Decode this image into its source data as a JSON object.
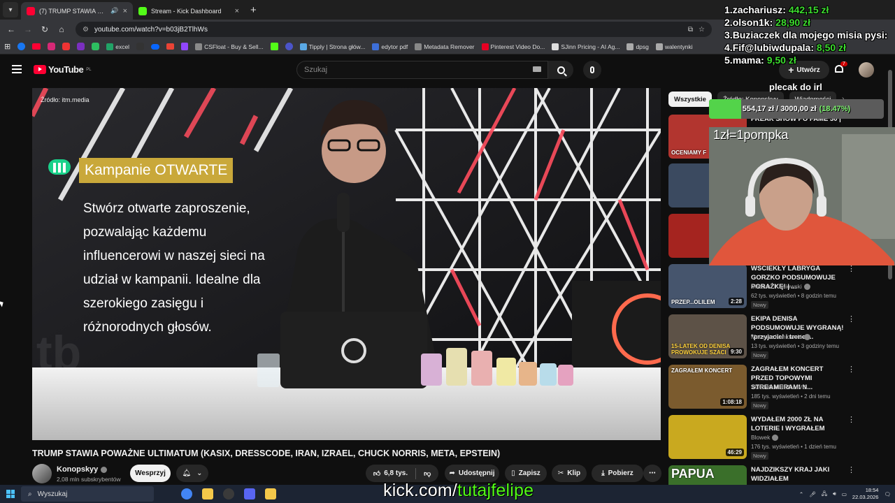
{
  "browser": {
    "tabs": [
      {
        "title": "(7) TRUMP STAWIA POWAŻ",
        "favicon_color": "#ff0033",
        "active": true
      },
      {
        "title": "Stream - Kick Dashboard",
        "favicon_color": "#53fc18",
        "active": false
      }
    ],
    "new_tab_icon": "plus-icon",
    "url": "youtube.com/watch?v=b03jB2TlhWs",
    "bookmarks": [
      {
        "label": "excel",
        "color": "#21a366"
      },
      {
        "label": "CSFloat - Buy & Sell...",
        "color": "#8a8a8a"
      },
      {
        "label": "Tipply | Strona głów...",
        "color": "#5aa9e6"
      },
      {
        "label": "edytor pdf",
        "color": "#3d6fd9"
      },
      {
        "label": "Metadata Remover",
        "color": "#888888"
      },
      {
        "label": "Pinterest Video Do...",
        "color": "#e60023"
      },
      {
        "label": "SJinn Pricing - AI Ag...",
        "color": "#dddddd"
      },
      {
        "label": "dpsg",
        "color": "#aaaaaa"
      },
      {
        "label": "walentynki",
        "color": "#aaaaaa"
      }
    ]
  },
  "youtube": {
    "logo_text": "YouTube",
    "region": "PL",
    "search_placeholder": "Szukaj",
    "create_label": "Utwórz",
    "notifications_count": "7",
    "video": {
      "source_label": "Źródło: itm.media",
      "campaign_title": "Kampanie OTWARTE",
      "campaign_body": "Stwórz otwarte zaproszenie, pozwalając każdemu influencerowi w naszej sieci na udział w kampanii. Idealne dla szerokiego zasięgu i różnorodnych głosów.",
      "title": "TRUMP STAWIA POWAŻNE ULTIMATUM (KASIX, DRESSCODE, IRAN, IZRAEL, CHUCK NORRIS, META, EPSTEIN)",
      "channel": "Konopskyy",
      "subscribers": "2,08 mln subskrybentów",
      "support_label": "Wesprzyj",
      "likes": "6,8 tys.",
      "share_label": "Udostępnij",
      "save_label": "Zapisz",
      "clip_label": "Klip",
      "download_label": "Pobierz"
    },
    "chips": [
      "Wszystkie",
      "Źródło: Konopskyy",
      "Wiadomości"
    ],
    "recommendations": [
      {
        "title": "FREAK SHOW PO FAME 30 |",
        "channel": "",
        "meta": "",
        "duration": "",
        "thumb_text": "OCENIAMY F",
        "thumb_color": "#b2352f",
        "new": false
      },
      {
        "title": "",
        "channel": "",
        "meta": "",
        "duration": "",
        "thumb_text": "",
        "thumb_color": "#3b4a60",
        "new": false
      },
      {
        "title": "",
        "channel": "",
        "meta": "",
        "duration": "",
        "thumb_text": "",
        "thumb_color": "#a5241f",
        "new": false
      },
      {
        "title": "WŚCIEKŁY LABRYGA GORZKO PODSUMOWUJE PORAŻKĘ! | ...",
        "channel": "Mateusz Kaniowski",
        "meta": "62 tys. wyświetleń • 8 godzin temu",
        "duration": "2:28",
        "thumb_text": "PRZEP...OLILEM",
        "thumb_color": "#46556d",
        "new": true
      },
      {
        "title": "EKIPA DENISA PODSUMOWUJE WYGRANĄ! *przyjaciel i trener...",
        "channel": "Mateusz Kaniowski",
        "meta": "13 tys. wyświetleń • 3 godziny temu",
        "duration": "9:30",
        "thumb_text": "15-LATEK OD DENISA PROWOKUJE SZACI",
        "thumb_color": "#5d5247",
        "new": true
      },
      {
        "title": "ZAGRAŁEM KONCERT PRZED TOPOWYMI STREAMERAMI N...",
        "channel": "YOUNG MULTI LIVE",
        "meta": "185 tys. wyświetleń • 2 dni temu",
        "duration": "1:08:18",
        "thumb_text": "ZAGRAŁEM KONCERT",
        "thumb_color": "#7b5b2e",
        "new": true
      },
      {
        "title": "WYDAŁEM 2000 ZŁ NA LOTERIE I WYGRAŁEM",
        "channel": "Blowek",
        "meta": "176 tys. wyświetleń • 1 dzień temu",
        "duration": "46:29",
        "thumb_text": "",
        "thumb_color": "#c9a91f",
        "new": true
      },
      {
        "title": "NAJDZIKSZY KRAJ JAKI WIDZIAŁEM",
        "channel": "",
        "meta": "",
        "duration": "",
        "thumb_text": "PAPUA",
        "thumb_color": "#3a6f2a",
        "new": false
      }
    ]
  },
  "stream_overlay": {
    "donors": [
      {
        "rank": "1.",
        "name": "zachariusz:",
        "amount": "442,15 zł"
      },
      {
        "rank": "2.",
        "name": "olson1k:",
        "amount": "28,90 zł"
      },
      {
        "rank": "3.",
        "name": "Buziaczek dla mojego misia pysi:",
        "amount": ""
      },
      {
        "rank": "4.",
        "name": "Fif@lubiwdupala:",
        "amount": "8,50 zł"
      },
      {
        "rank": "5.",
        "name": "mama:",
        "amount": "9,50 zł"
      }
    ],
    "goal_title": "plecak do irl",
    "goal_amount": "554,17 zł / 3000,00 zł",
    "goal_percent_text": "(18.47%)",
    "goal_fraction": 0.1847,
    "pushup_rule": "1zł=1pompka",
    "kick_prefix": "kick.com/",
    "kick_handle": "tutajfelipe"
  },
  "taskbar": {
    "search_label": "Wyszukaj",
    "time": "18:54",
    "date": "22.03.2026",
    "apps": [
      {
        "name": "chrome",
        "color": "#4285f4"
      },
      {
        "name": "explorer",
        "color": "#f4c84a"
      },
      {
        "name": "obs",
        "color": "#3a3a3a"
      },
      {
        "name": "discord",
        "color": "#5865f2"
      },
      {
        "name": "app",
        "color": "#f4c84a"
      }
    ]
  }
}
